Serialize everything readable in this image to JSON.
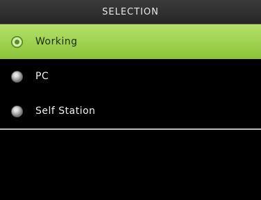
{
  "title": "SELECTION",
  "menu": {
    "items": [
      {
        "label": "Working",
        "selected": true,
        "icon": "radio-on-icon"
      },
      {
        "label": "PC",
        "selected": false,
        "icon": "radio-off-icon"
      },
      {
        "label": "Self Station",
        "selected": false,
        "icon": "radio-off-icon"
      }
    ]
  },
  "colors": {
    "selected_bg": "#9ccf4a",
    "background": "#000000",
    "title_bar": "#2e2e2e",
    "divider": "#bdbdbd"
  }
}
